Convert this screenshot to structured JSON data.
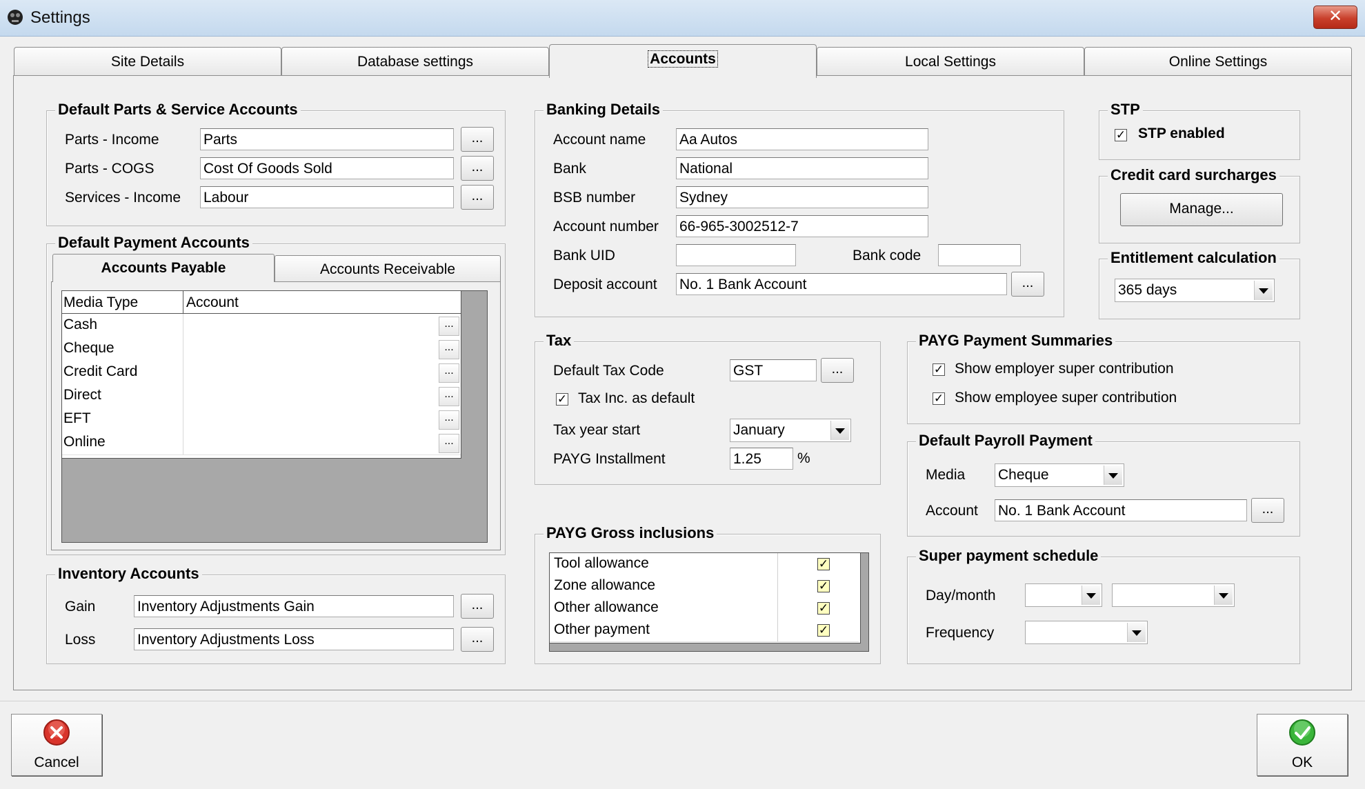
{
  "window": {
    "title": "Settings",
    "close_label": "✕"
  },
  "tabs": [
    {
      "label": "Site Details"
    },
    {
      "label": "Database settings"
    },
    {
      "label": "Accounts"
    },
    {
      "label": "Local Settings"
    },
    {
      "label": "Online Settings"
    }
  ],
  "parts_service": {
    "title": "Default Parts & Service Accounts",
    "rows": [
      {
        "label": "Parts - Income",
        "value": "Parts"
      },
      {
        "label": "Parts - COGS",
        "value": "Cost Of Goods Sold"
      },
      {
        "label": "Services - Income",
        "value": "Labour"
      }
    ],
    "browse_label": "..."
  },
  "payment_accounts": {
    "title": "Default Payment Accounts",
    "subtabs": [
      "Accounts Payable",
      "Accounts Receivable"
    ],
    "columns": [
      "Media Type",
      "Account"
    ],
    "rows": [
      {
        "media": "Cash",
        "account": ""
      },
      {
        "media": "Cheque",
        "account": ""
      },
      {
        "media": "Credit Card",
        "account": ""
      },
      {
        "media": "Direct",
        "account": ""
      },
      {
        "media": "EFT",
        "account": ""
      },
      {
        "media": "Online",
        "account": ""
      }
    ],
    "browse_label": "..."
  },
  "inventory": {
    "title": "Inventory Accounts",
    "rows": [
      {
        "label": "Gain",
        "value": "Inventory Adjustments Gain"
      },
      {
        "label": "Loss",
        "value": "Inventory Adjustments Loss"
      }
    ],
    "browse_label": "..."
  },
  "banking": {
    "title": "Banking Details",
    "account_name_label": "Account name",
    "account_name": "Aa Autos",
    "bank_label": "Bank",
    "bank": "National",
    "bsb_label": "BSB number",
    "bsb": "Sydney",
    "account_number_label": "Account number",
    "account_number": "66-965-3002512-7",
    "bank_uid_label": "Bank UID",
    "bank_uid": "",
    "bank_code_label": "Bank code",
    "bank_code": "",
    "deposit_label": "Deposit account",
    "deposit": "No. 1 Bank Account",
    "browse_label": "..."
  },
  "tax": {
    "title": "Tax",
    "default_code_label": "Default Tax Code",
    "default_code": "GST",
    "tax_inc_label": "Tax Inc. as default",
    "tax_inc_checked": true,
    "year_start_label": "Tax year start",
    "year_start": "January",
    "payg_label": "PAYG Installment",
    "payg_value": "1.25",
    "payg_unit": "%",
    "browse_label": "..."
  },
  "payg_gross": {
    "title": "PAYG Gross inclusions",
    "rows": [
      {
        "label": "Tool allowance",
        "checked": true
      },
      {
        "label": "Zone allowance",
        "checked": true
      },
      {
        "label": "Other allowance",
        "checked": true
      },
      {
        "label": "Other payment",
        "checked": true
      }
    ]
  },
  "stp": {
    "title": "STP",
    "enabled_label": "STP enabled",
    "enabled": true
  },
  "surcharges": {
    "title": "Credit card surcharges",
    "manage_label": "Manage..."
  },
  "entitlement": {
    "title": "Entitlement calculation",
    "value": "365 days"
  },
  "payg_summaries": {
    "title": "PAYG Payment Summaries",
    "employer_label": "Show employer super contribution",
    "employer_checked": true,
    "employee_label": "Show employee super contribution",
    "employee_checked": true
  },
  "payroll_payment": {
    "title": "Default Payroll Payment",
    "media_label": "Media",
    "media": "Cheque",
    "account_label": "Account",
    "account": "No. 1 Bank Account",
    "browse_label": "..."
  },
  "super_schedule": {
    "title": "Super payment schedule",
    "daymonth_label": "Day/month",
    "day": "",
    "month": "",
    "frequency_label": "Frequency",
    "frequency": ""
  },
  "footer": {
    "cancel_label": "Cancel",
    "ok_label": "OK"
  },
  "check_mark": "✓"
}
